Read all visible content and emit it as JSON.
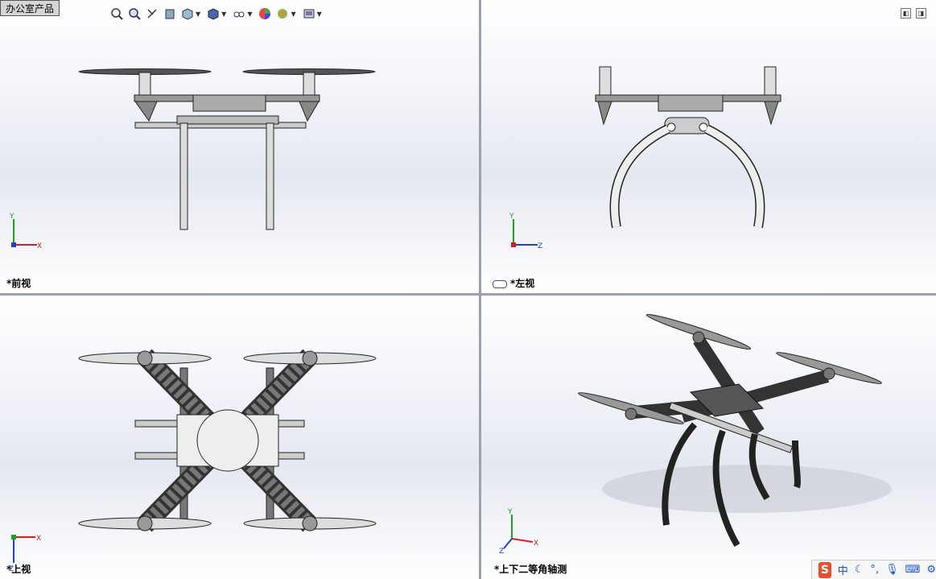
{
  "app": {
    "part_tag": "办公室产品"
  },
  "viewports": {
    "front": {
      "label": "*前视",
      "triad": {
        "up": "Y",
        "right": "X"
      }
    },
    "left": {
      "label": "*左视",
      "triad": {
        "up": "Y",
        "right": "Z"
      }
    },
    "top": {
      "label": "*上视",
      "triad": {
        "up": "Z",
        "right": "X"
      }
    },
    "iso": {
      "label": "*上下二等角轴测",
      "triad": {
        "up": "Y",
        "right": "X",
        "down": "Z"
      }
    }
  },
  "heads_up_toolbar": {
    "icons": [
      "zoom-to-fit-icon",
      "zoom-to-area-icon",
      "previous-view-icon",
      "section-view-icon",
      "view-orientation-icon",
      "display-style-icon",
      "hide-show-items-icon",
      "edit-appearance-icon",
      "apply-scene-icon",
      "view-settings-icon"
    ]
  },
  "ime_tray": {
    "logo": "S",
    "lang": "中",
    "items": [
      "moon-icon",
      "punctuation-icon",
      "microphone-icon",
      "keyboard-icon",
      "toolbox-icon"
    ]
  },
  "colors": {
    "viewport_bg_top": "#ffffff",
    "viewport_bg_mid": "#e4e8f0",
    "divider": "#9aa2b0",
    "axis_x": "#d02020",
    "axis_y": "#20a020",
    "axis_z": "#2040d0"
  }
}
